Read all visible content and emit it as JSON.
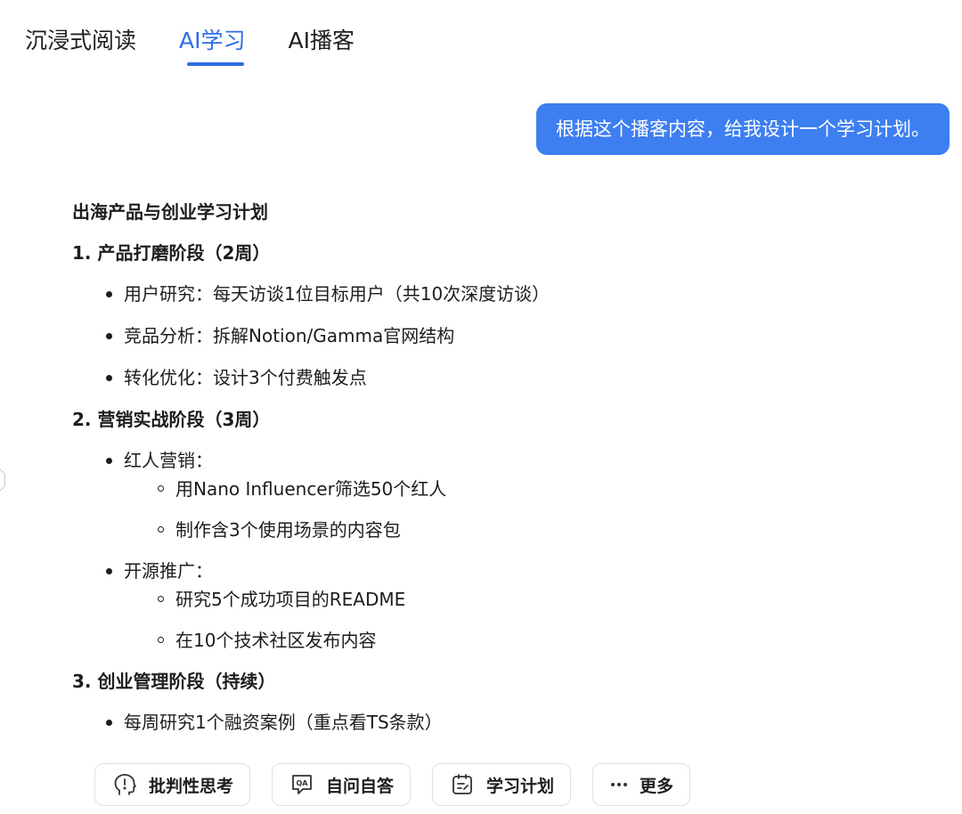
{
  "tabs": [
    {
      "label": "沉浸式阅读",
      "active": false
    },
    {
      "label": "AI学习",
      "active": true
    },
    {
      "label": "AI播客",
      "active": false
    }
  ],
  "user_message": "根据这个播客内容，给我设计一个学习计划。",
  "plan": {
    "title": "出海产品与创业学习计划",
    "sections": [
      {
        "heading": "1. 产品打磨阶段（2周）",
        "items": [
          {
            "text": "用户研究：每天访谈1位目标用户（共10次深度访谈）"
          },
          {
            "text": "竞品分析：拆解Notion/Gamma官网结构"
          },
          {
            "text": "转化优化：设计3个付费触发点"
          }
        ]
      },
      {
        "heading": "2. 营销实战阶段（3周）",
        "items": [
          {
            "text": "红人营销：",
            "sub": [
              "用Nano Influencer筛选50个红人",
              "制作含3个使用场景的内容包"
            ]
          },
          {
            "text": "开源推广：",
            "sub": [
              "研究5个成功项目的README",
              "在10个技术社区发布内容"
            ]
          }
        ]
      },
      {
        "heading": "3. 创业管理阶段（持续）",
        "items": [
          {
            "text": "每周研究1个融资案例（重点看TS条款）"
          }
        ]
      }
    ]
  },
  "actions": [
    {
      "label": "批判性思考",
      "icon": "head-thinking-icon"
    },
    {
      "label": "自问自答",
      "icon": "qa-chat-icon"
    },
    {
      "label": "学习计划",
      "icon": "plan-clipboard-icon"
    },
    {
      "label": "更多",
      "icon": "more-dots-icon"
    }
  ],
  "colors": {
    "accent": "#2f6ce5",
    "bubble": "#3d7ef0"
  }
}
